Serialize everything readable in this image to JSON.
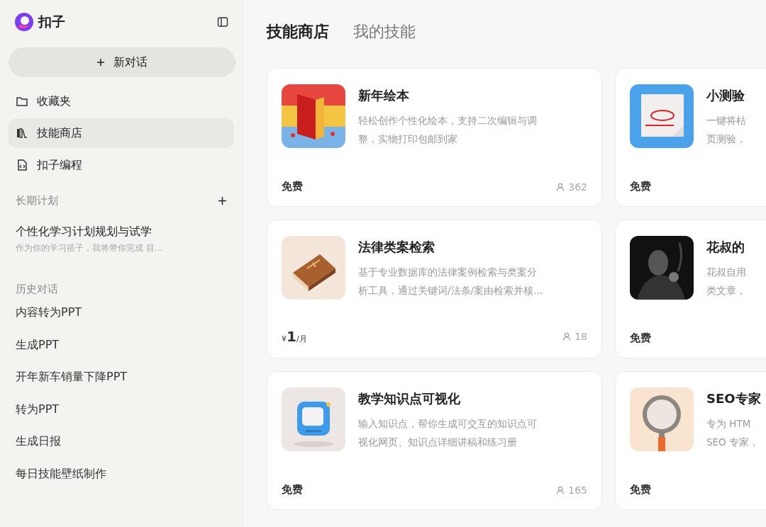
{
  "sidebar": {
    "app_name": "扣子",
    "new_chat_button": "新对话",
    "nav_items": [
      {
        "label": "收藏夹",
        "selected": false
      },
      {
        "label": "技能商店",
        "selected": true
      },
      {
        "label": "扣子编程",
        "selected": false
      }
    ],
    "plans": {
      "heading": "长期计划",
      "items": [
        {
          "title": "个性化学习计划规划与试学",
          "subtitle": "作为你的学习搭子，我将带你完成 目..."
        }
      ]
    },
    "history": {
      "heading": "历史对话",
      "items": [
        "内容转为PPT",
        "生成PPT",
        "开年新车销量下降PPT",
        "转为PPT",
        "生成日报",
        "每日技能壁纸制作"
      ]
    }
  },
  "tabs": [
    {
      "label": "技能商店",
      "selected": true
    },
    {
      "label": "我的技能",
      "selected": false
    }
  ],
  "cards": [
    {
      "title": "新年绘本",
      "description": [
        "轻松创作个性化绘本，支持二次编辑与调",
        "整，实物打印包邮到家"
      ],
      "price": {
        "kind": "free",
        "label": "免费"
      },
      "users": "362"
    },
    {
      "title": "小测验",
      "description": [
        "一键将枯",
        "页测验，"
      ],
      "price": {
        "kind": "free",
        "label": "免费"
      }
    },
    {
      "title": "法律类案检索",
      "description": [
        "基于专业数据库的法律案例检索与类案分",
        "析工具，通过关键词/法条/案由检索并核..."
      ],
      "price": {
        "kind": "paid",
        "currency": "¥",
        "amount": "1",
        "unit": "/月"
      },
      "users": "18"
    },
    {
      "title": "花叔的",
      "description": [
        "花叔自用",
        "类文章，"
      ],
      "price": {
        "kind": "free",
        "label": "免费"
      }
    },
    {
      "title": "教学知识点可视化",
      "description": [
        "输入知识点，帮你生成可交互的知识点可",
        "视化网页、知识点详细讲稿和练习册"
      ],
      "price": {
        "kind": "free",
        "label": "免费"
      },
      "users": "165"
    },
    {
      "title": "SEO专家",
      "description": [
        "专为 HTM",
        "SEO 专家，"
      ],
      "price": {
        "kind": "free",
        "label": "免费"
      }
    }
  ]
}
